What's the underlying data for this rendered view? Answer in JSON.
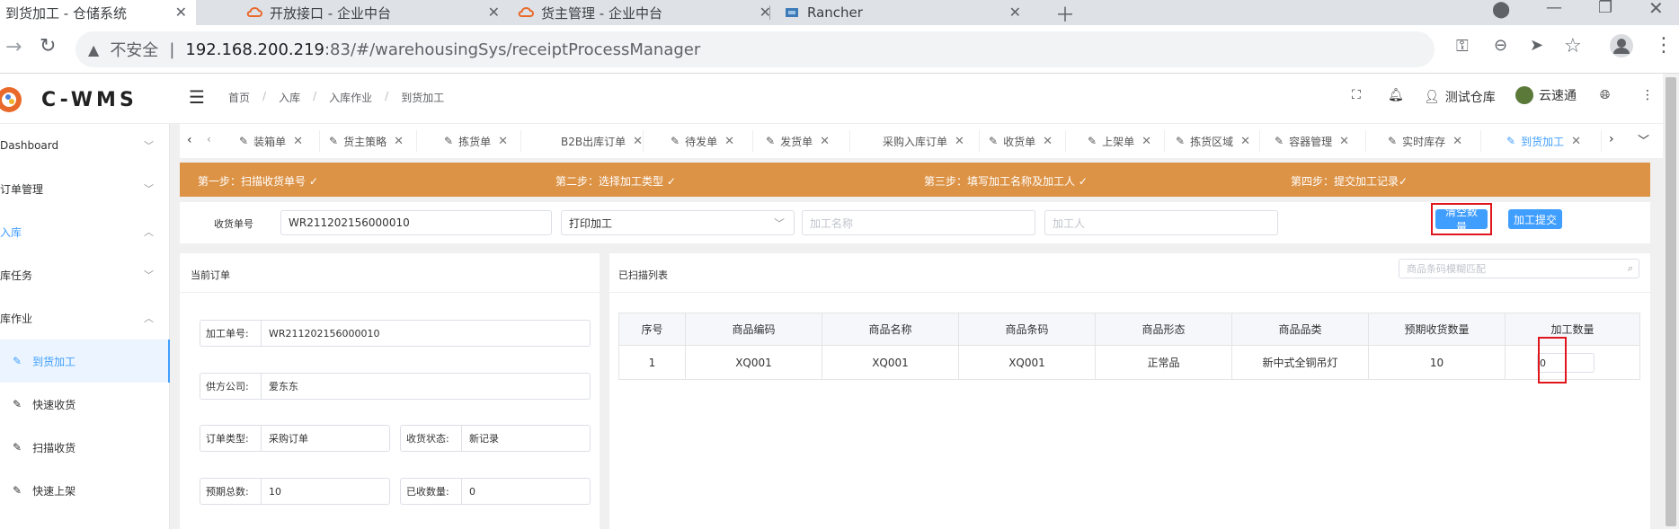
{
  "browser": {
    "tabs": [
      {
        "title": "到货加工 - 仓储系统",
        "active": true
      },
      {
        "title": "开放接口 - 企业中台",
        "active": false
      },
      {
        "title": "货主管理 - 企业中台",
        "active": false
      },
      {
        "title": "Rancher",
        "active": false
      }
    ],
    "security_label": "不安全",
    "url_host": "192.168.200.219",
    "url_rest": ":83/#/warehousingSys/receiptProcessManager"
  },
  "header": {
    "logo_text": "C-WMS",
    "breadcrumb": [
      "首页",
      "入库",
      "入库作业",
      "到货加工"
    ],
    "warehouse": "测试仓库",
    "user": "云速通"
  },
  "sidebar": {
    "items": [
      {
        "label": "Dashboard",
        "chevron": "﹀"
      },
      {
        "label": "订单管理",
        "chevron": "﹀"
      },
      {
        "label": "入库",
        "chevron": "︿"
      },
      {
        "label": "库任务",
        "chevron": "﹀"
      },
      {
        "label": "库作业",
        "chevron": "︿"
      }
    ],
    "subitems": [
      {
        "label": "到货加工"
      },
      {
        "label": "快速收货"
      },
      {
        "label": "扫描收货"
      },
      {
        "label": "快速上架"
      }
    ]
  },
  "tags": [
    "装箱单",
    "货主策略",
    "拣货单",
    "B2B出库订单",
    "待发单",
    "发货单",
    "采购入库订单",
    "收货单",
    "上架单",
    "拣货区域",
    "容器管理",
    "实时库存",
    "到货加工"
  ],
  "steps": [
    "第一步：扫描收货单号 ✓",
    "第二步：选择加工类型 ✓",
    "第三步：填写加工名称及加工人 ✓",
    "第四步：提交加工记录✓"
  ],
  "form": {
    "receipt_label": "收货单号",
    "receipt_value": "WR211202156000010",
    "process_type": "打印加工",
    "name_placeholder": "加工名称",
    "person_placeholder": "加工人",
    "clear_button": "清空数量",
    "submit_button": "加工提交"
  },
  "current_order": {
    "title": "当前订单",
    "fields": [
      {
        "key": "加工单号:",
        "value": "WR211202156000010"
      },
      {
        "key": "供方公司:",
        "value": "爱东东"
      },
      {
        "key": "订单类型:",
        "value": "采购订单"
      },
      {
        "key": "收货状态:",
        "value": "新记录"
      },
      {
        "key": "预期总数:",
        "value": "10"
      },
      {
        "key": "已收数量:",
        "value": "0"
      }
    ]
  },
  "scanned": {
    "title": "已扫描列表",
    "search_placeholder": "商品条码模糊匹配",
    "columns": [
      "序号",
      "商品编码",
      "商品名称",
      "商品条码",
      "商品形态",
      "商品品类",
      "预期收货数量",
      "加工数量"
    ],
    "rows": [
      [
        "1",
        "XQ001",
        "XQ001",
        "XQ001",
        "正常品",
        "新中式全铜吊灯",
        "10",
        "0"
      ]
    ]
  },
  "colors": {
    "accent": "#409eff",
    "steps_bg": "#dd9346",
    "highlight": "#e0161c"
  }
}
